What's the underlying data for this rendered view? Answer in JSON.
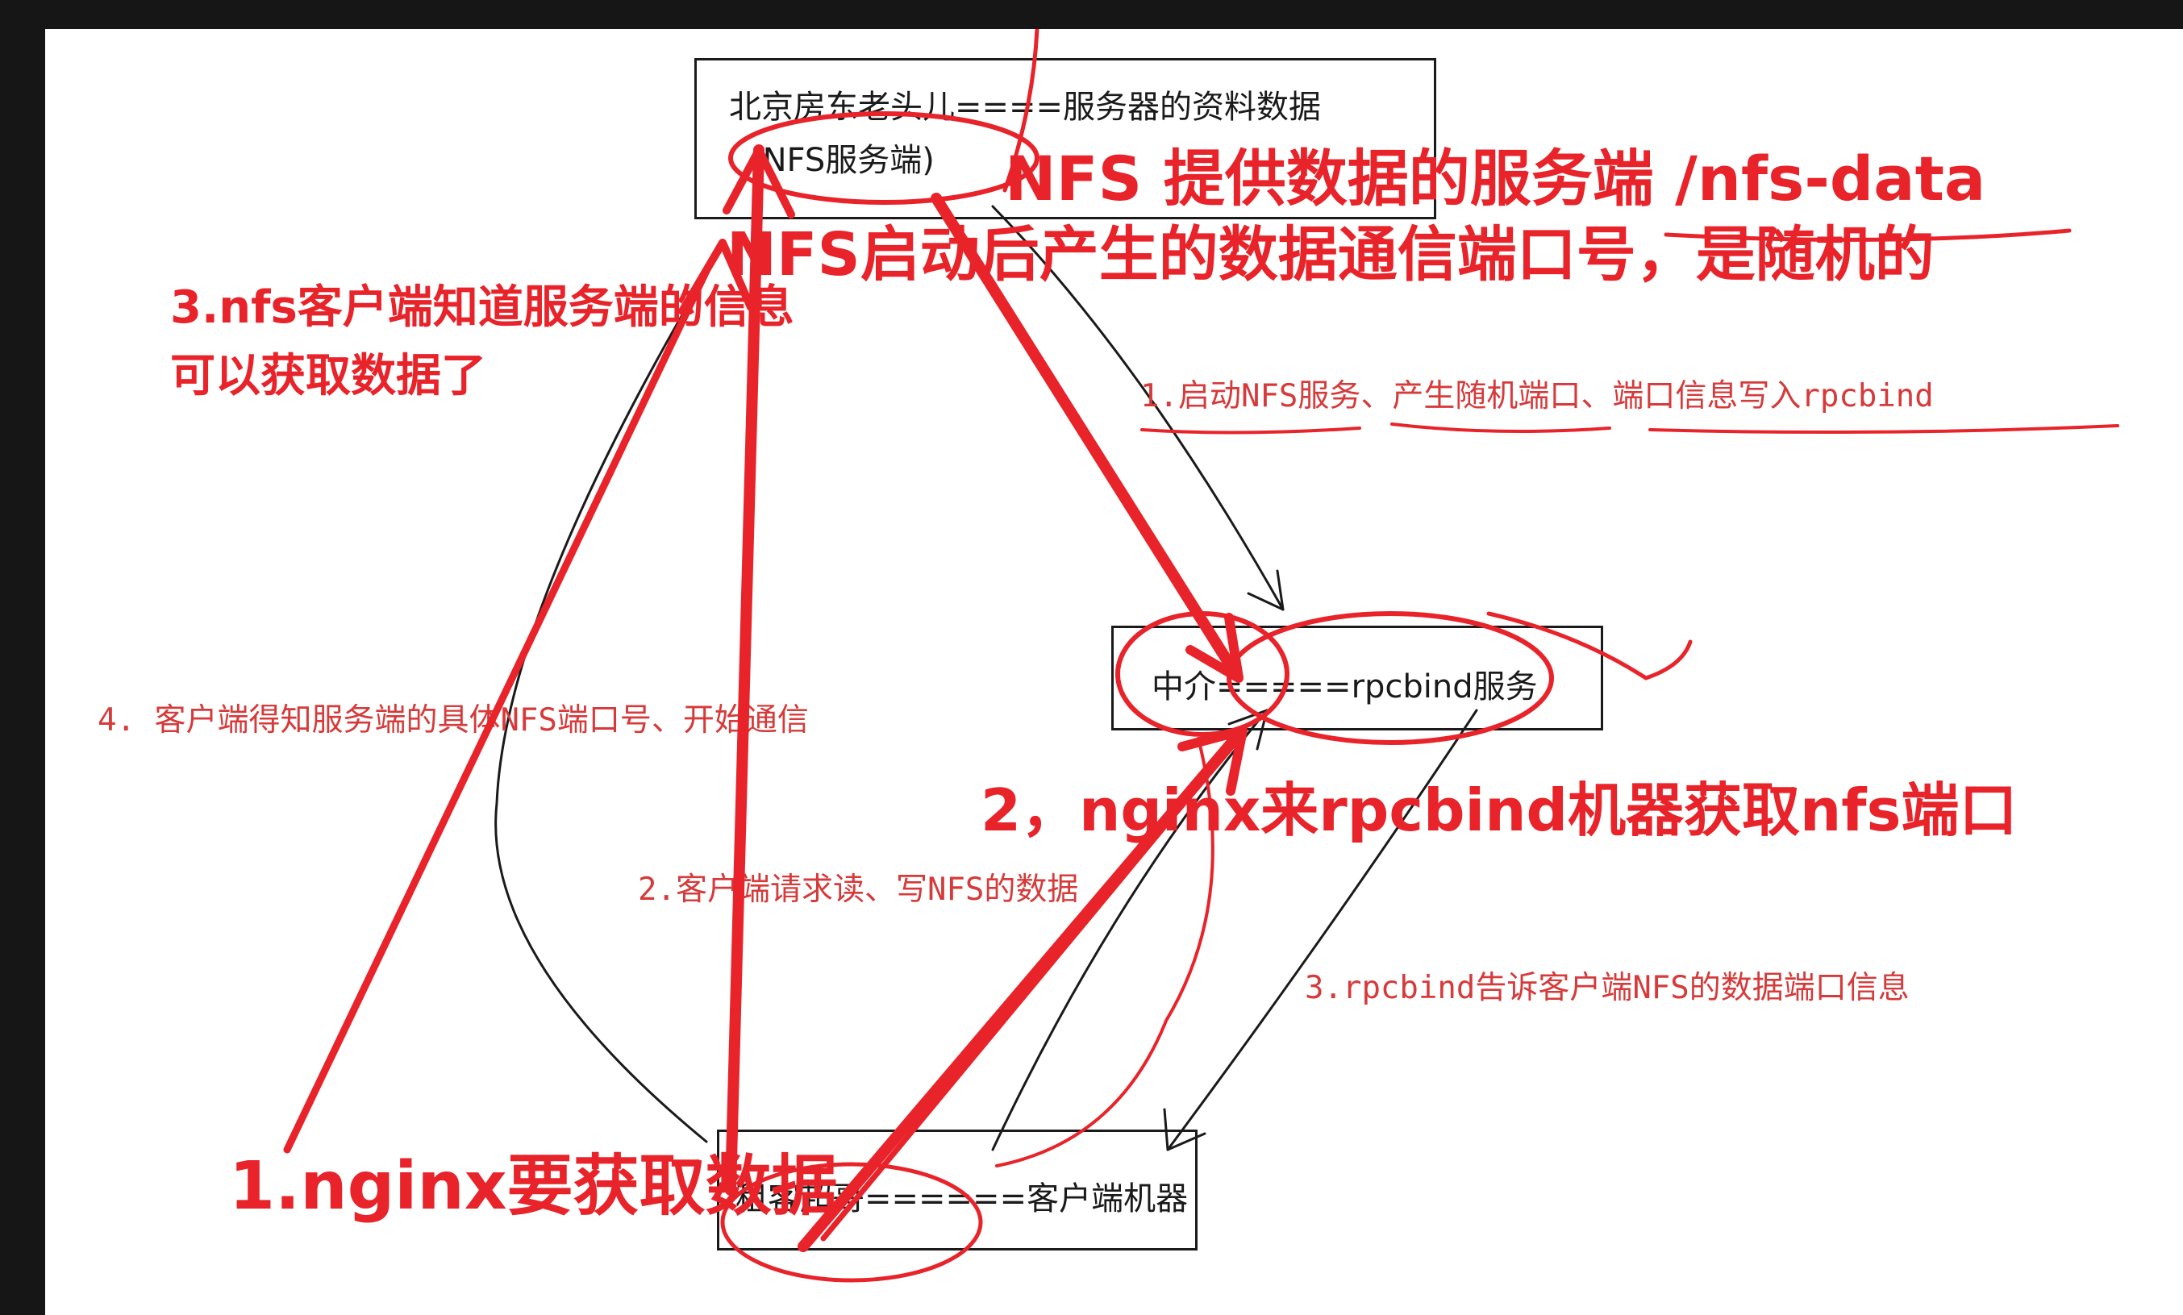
{
  "colors": {
    "background": "#161616",
    "canvas": "#ffffff",
    "ink": "#1a1a1a",
    "annotation_red": "#e8232a",
    "label_red": "#d63a3a"
  },
  "nodes": {
    "server_line1": "北京房东老头儿====服务器的资料数据",
    "server_line2": "(NFS服务端)",
    "rpcbind": "中介=====rpcbind服务",
    "client": "租客超哥======客户端机器"
  },
  "edge_labels": {
    "start_nfs": "1.启动NFS服务、产生随机端口、端口信息写入rpcbind",
    "client_request": "2.客户端请求读、写NFS的数据",
    "rpcbind_reply": "3.rpcbind告诉客户端NFS的数据端口信息",
    "begin_comm": "4. 客户端得知服务端的具体NFS端口号、开始通信"
  },
  "annotations": {
    "nfs_server": "NFS 提供数据的服务端 /nfs-data",
    "random_port": "NFS启动后产生的数据通信端口号，是随机的",
    "client_knows_line1": "3.nfs客户端知道服务端的信息",
    "client_knows_line2": "可以获取数据了",
    "nginx_rpcbind": "2，nginx来rpcbind机器获取nfs端口",
    "nginx_fetch": "1.nginx要获取数据"
  }
}
